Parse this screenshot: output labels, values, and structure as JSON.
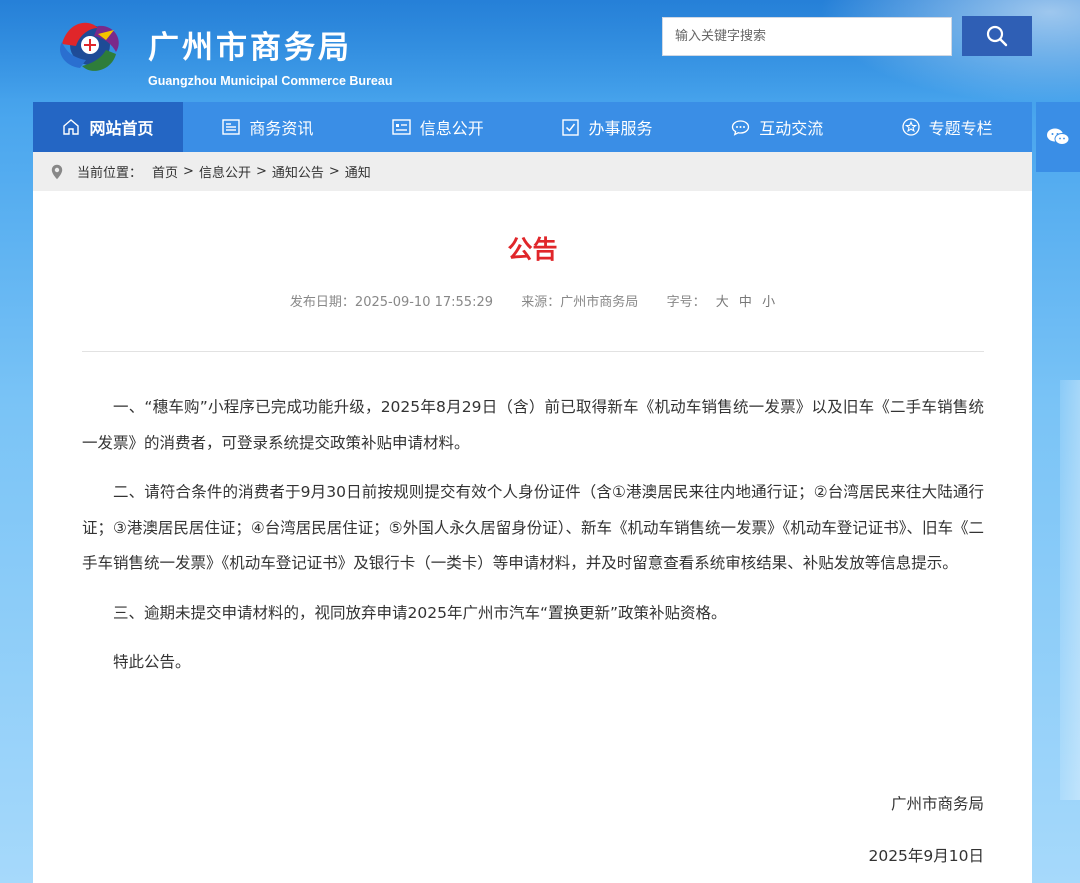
{
  "header": {
    "title_cn": "广州市商务局",
    "title_en": "Guangzhou Municipal Commerce Bureau",
    "search_placeholder": "输入关键字搜索"
  },
  "nav": {
    "items": [
      {
        "label": "网站首页",
        "icon": "home-icon",
        "active": true
      },
      {
        "label": "商务资讯",
        "icon": "news-icon"
      },
      {
        "label": "信息公开",
        "icon": "info-card-icon"
      },
      {
        "label": "办事服务",
        "icon": "check-box-icon"
      },
      {
        "label": "互动交流",
        "icon": "chat-bubble-icon"
      },
      {
        "label": "专题专栏",
        "icon": "star-circle-icon"
      }
    ]
  },
  "breadcrumb": {
    "prefix": "当前位置：",
    "items": [
      "首页",
      "信息公开",
      "通知公告",
      "通知"
    ],
    "separator": ">"
  },
  "article": {
    "title": "公告",
    "publish_label": "发布日期：",
    "publish_date": "2025-09-10 17:55:29",
    "source_label": "来源：",
    "source": "广州市商务局",
    "fontsize_label": "字号：",
    "fontsize_options": [
      "大",
      "中",
      "小"
    ],
    "paragraphs": [
      "一、“穗车购”小程序已完成功能升级，2025年8月29日（含）前已取得新车《机动车销售统一发票》以及旧车《二手车销售统一发票》的消费者，可登录系统提交政策补贴申请材料。",
      "二、请符合条件的消费者于9月30日前按规则提交有效个人身份证件（含①港澳居民来往内地通行证；②台湾居民来往大陆通行证；③港澳居民居住证；④台湾居民居住证；⑤外国人永久居留身份证）、新车《机动车销售统一发票》《机动车登记证书》、旧车《二手车销售统一发票》《机动车登记证书》及银行卡（一类卡）等申请材料，并及时留意查看系统审核结果、补贴发放等信息提示。",
      "三、逾期未提交申请材料的，视同放弃申请2025年广州市汽车“置换更新”政策补贴资格。",
      "特此公告。"
    ],
    "signature_org": "广州市商务局",
    "signature_date": "2025年9月10日"
  },
  "colors": {
    "nav_bg": "#3a8ee6",
    "nav_active": "#2466c4",
    "title_red": "#e0262a",
    "search_btn": "#2f5fb5"
  }
}
